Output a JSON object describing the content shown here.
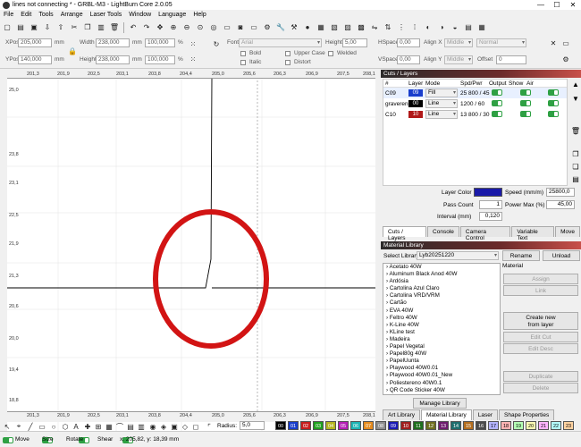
{
  "window": {
    "title": "lines not connecting * - GRBL-M3 - LightBurn Core 2.0.05",
    "minimize": "—",
    "maximize": "☐",
    "close": "✕"
  },
  "menu": [
    "File",
    "Edit",
    "Tools",
    "Arrange",
    "Laser Tools",
    "Window",
    "Language",
    "Help"
  ],
  "toolbar2": {
    "xpos_label": "XPos",
    "xpos": "205,000",
    "ypos_label": "YPos",
    "ypos": "140,000",
    "unit": "mm",
    "width_label": "Width",
    "width": "238,000",
    "height_label": "Height",
    "height": "238,000",
    "scale_w": "100,000",
    "scale_h": "100,000",
    "pct": "%",
    "font_label": "Font",
    "font_value": "Arial",
    "fheight_label": "Height",
    "fheight": "5,00",
    "hspace_label": "HSpace",
    "hspace": "0,00",
    "vspace_label": "VSpace",
    "vspace": "0,00",
    "aligny_label": "Align Y",
    "alignx_label": "Align X",
    "align_middle": "Middle",
    "normal": "Normal",
    "offset_label": "Offset",
    "offset": "0",
    "bold": "Bold",
    "italic": "Italic",
    "upper": "Upper Case",
    "distort": "Distort",
    "welded": "Welded"
  },
  "ruler_top": [
    "201,3",
    "201,9",
    "202,5",
    "203,1",
    "203,8",
    "204,4",
    "205,0",
    "205,6",
    "206,3",
    "206,9",
    "207,5",
    "208,1"
  ],
  "ruler_bottom": [
    "201,3",
    "201,9",
    "202,5",
    "203,1",
    "203,8",
    "204,4",
    "205,0",
    "205,6",
    "206,3",
    "206,9",
    "207,5",
    "208,1"
  ],
  "ruler_left": [
    "25,0",
    "23,8",
    "23,1",
    "22,5",
    "21,9",
    "21,3",
    "20,6",
    "20,0",
    "19,4",
    "18,8"
  ],
  "cuts": {
    "header": "Cuts / Layers",
    "cols": [
      "#",
      "Layer",
      "Mode",
      "Spd/Pwr",
      "Output",
      "Show",
      "Air"
    ],
    "rows": [
      {
        "name": "C09",
        "num": "09",
        "color": "#1a3ecc",
        "mode": "Fill",
        "spd": "25 800 / 45"
      },
      {
        "name": "graveren",
        "num": "00",
        "color": "#000000",
        "mode": "Line",
        "spd": "1200 / 60"
      },
      {
        "name": "C10",
        "num": "10",
        "color": "#b01818",
        "mode": "Line",
        "spd": "13 800 / 30"
      }
    ],
    "layer_color_label": "Layer Color",
    "speed_label": "Speed (mm/m)",
    "speed": "25800,0",
    "pass_label": "Pass Count",
    "pass": "1",
    "power_label": "Power Max (%)",
    "power": "45,00",
    "interval_label": "Interval (mm)",
    "interval": "0,120"
  },
  "tabs1": [
    "Cuts / Layers",
    "Console",
    "Camera Control",
    "Variable Text",
    "Move"
  ],
  "library": {
    "header": "Material Library",
    "select_label": "Select Library",
    "select_value": "Lyb20251220",
    "rename": "Rename",
    "unload": "Unload",
    "material_label": "Material",
    "items": [
      "Acetato 40W",
      "Aluminum Black Anod 40W",
      "Ardósia",
      "Cartolina Azul Claro",
      "Cartolina VRD/VRM",
      "Cartão",
      "EVA 40W",
      "Feltro 40W",
      "K-Line 40W",
      "KLine test",
      "Madeira",
      "Papel Vegetal",
      "Papel80g 40W",
      "PapelUunta",
      "Playwood 40W0.01",
      "Playwood 40W0.01_New",
      "Poliestereno 40W0.1",
      "QR Code Sticker 40W"
    ],
    "assign": "Assign",
    "link": "Link",
    "create": "Create new\nfrom layer",
    "edit_cut": "Edit Cut",
    "edit_desc": "Edit Desc",
    "duplicate": "Duplicate",
    "delete": "Delete",
    "manage": "Manage Library"
  },
  "tabs2": [
    "Art Library",
    "Material Library",
    "Laser",
    "Shape Properties"
  ],
  "bottom_tools": {
    "radius_label": "Radius:",
    "radius": "5,0"
  },
  "palette": [
    "00",
    "01",
    "02",
    "03",
    "04",
    "05",
    "06",
    "07",
    "08",
    "09",
    "10",
    "11",
    "12",
    "13",
    "14",
    "15",
    "16",
    "17",
    "18",
    "19",
    "20",
    "21",
    "22",
    "23"
  ],
  "palette_colors": [
    "#000000",
    "#1a3ecc",
    "#c81e1e",
    "#1ea01e",
    "#b4b41e",
    "#b41eb4",
    "#1eb4b4",
    "#e68c1e",
    "#8c8c8c",
    "#1a1ab4",
    "#a01e1e",
    "#1e6e1e",
    "#6e6e1e",
    "#6e1e6e",
    "#1e6e6e",
    "#b46e1e",
    "#4b4b4b",
    "#b4b4ff",
    "#ffb4b4",
    "#b4ffb4",
    "#ffffb4",
    "#ffb4ff",
    "#b4ffff",
    "#ffd2a0"
  ],
  "status": {
    "move": "Move",
    "size": "Size",
    "rotate": "Rotate",
    "shear": "Shear",
    "coords": "x: 205,82, y: 18,39 mm"
  }
}
